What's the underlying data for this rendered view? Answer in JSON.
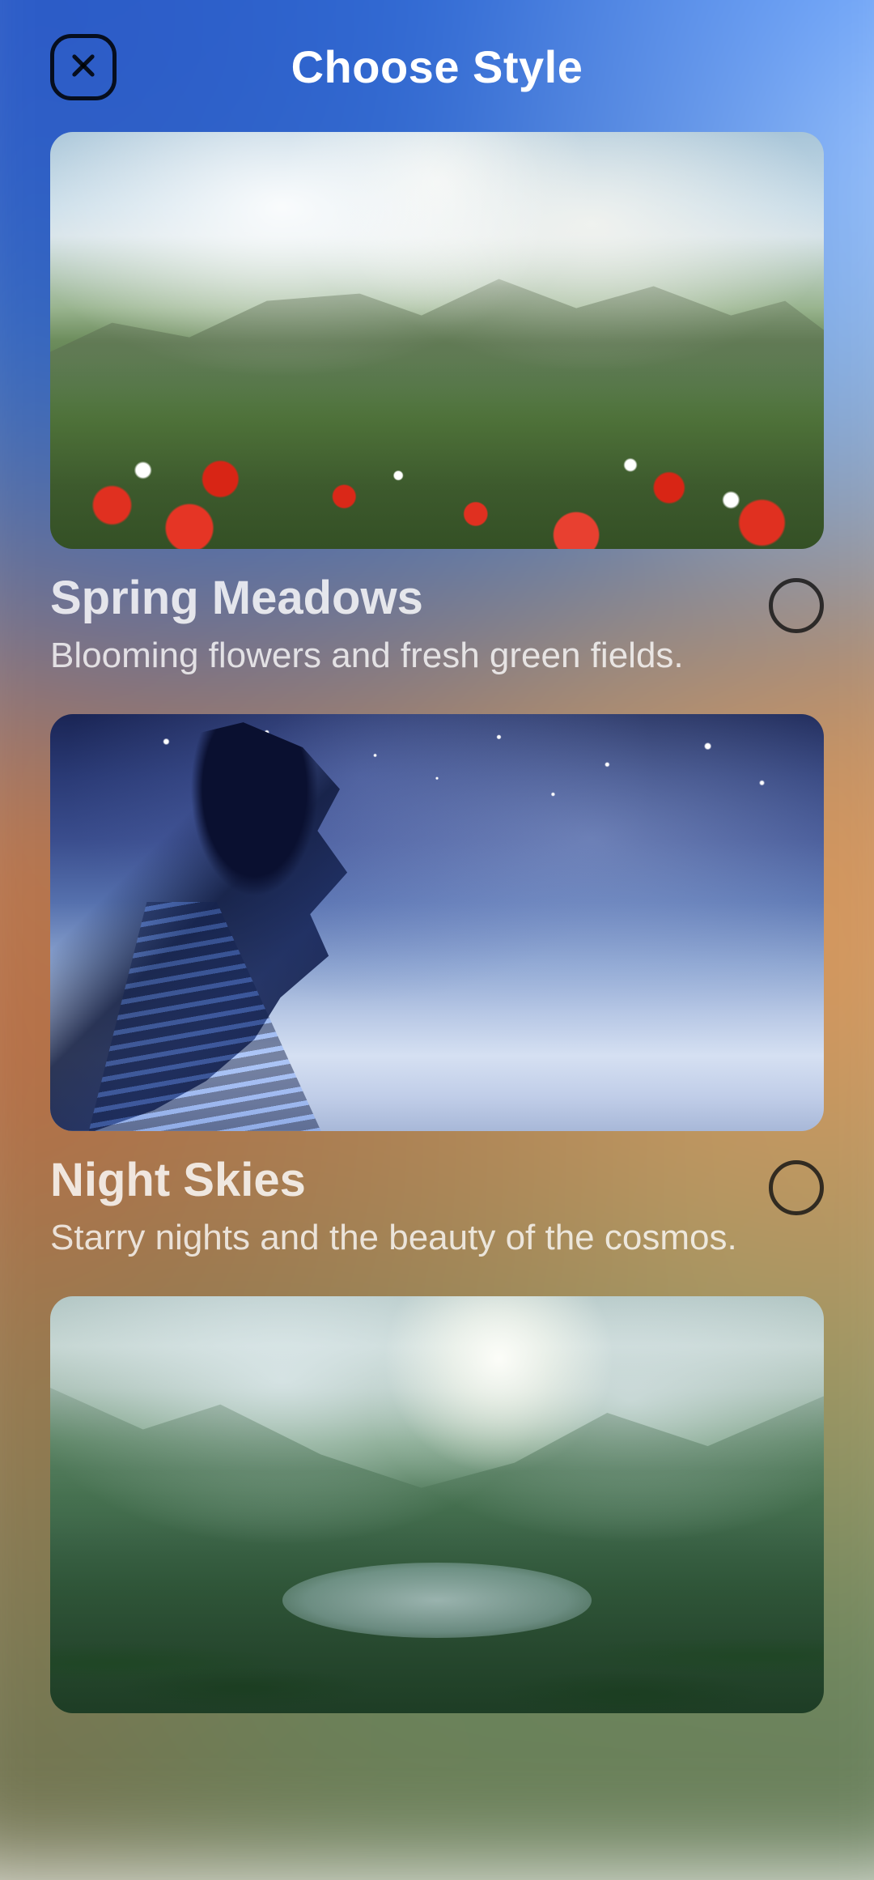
{
  "header": {
    "title": "Choose Style"
  },
  "styles": [
    {
      "id": "spring-meadows",
      "title": "Spring Meadows",
      "description": "Blooming flowers and fresh green fields.",
      "selected": false
    },
    {
      "id": "night-skies",
      "title": "Night Skies",
      "description": "Starry nights and the beauty of the cosmos.",
      "selected": false
    },
    {
      "id": "tropical-valley",
      "title": "",
      "description": "",
      "selected": false
    }
  ]
}
